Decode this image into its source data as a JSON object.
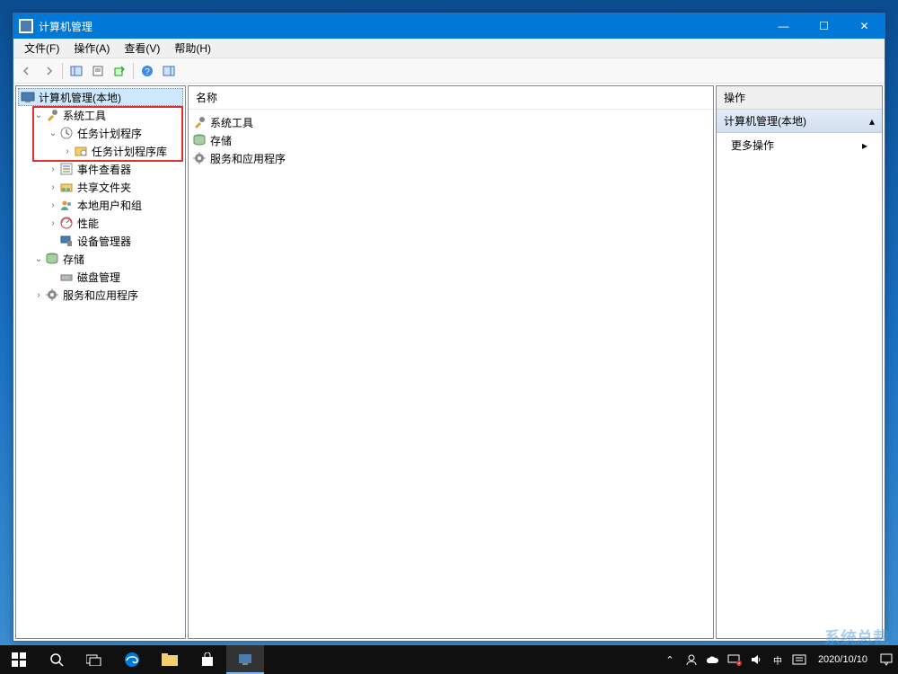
{
  "window": {
    "title": "计算机管理",
    "controls": {
      "minimize": "—",
      "maximize": "☐",
      "close": "✕"
    }
  },
  "menubar": {
    "items": [
      {
        "label": "文件(F)"
      },
      {
        "label": "操作(A)"
      },
      {
        "label": "查看(V)"
      },
      {
        "label": "帮助(H)"
      }
    ]
  },
  "toolbar": {
    "back": "←",
    "forward": "→",
    "up": "⇧",
    "props": "▦",
    "refresh": "⟳",
    "export": "↗",
    "help": "?",
    "show": "▤"
  },
  "tree": {
    "root": "计算机管理(本地)",
    "system_tools": "系统工具",
    "task_scheduler": "任务计划程序",
    "task_scheduler_library": "任务计划程序库",
    "event_viewer": "事件查看器",
    "shared_folders": "共享文件夹",
    "local_users_groups": "本地用户和组",
    "performance": "性能",
    "device_manager": "设备管理器",
    "storage": "存储",
    "disk_management": "磁盘管理",
    "services_applications": "服务和应用程序"
  },
  "main": {
    "column_header": "名称",
    "items": [
      {
        "label": "系统工具",
        "icon": "tools-icon"
      },
      {
        "label": "存储",
        "icon": "storage-icon"
      },
      {
        "label": "服务和应用程序",
        "icon": "services-icon"
      }
    ]
  },
  "actions": {
    "header": "操作",
    "section_title": "计算机管理(本地)",
    "more_actions": "更多操作"
  },
  "taskbar": {
    "datetime": "2020/10/10"
  },
  "watermark": "系统总裁"
}
